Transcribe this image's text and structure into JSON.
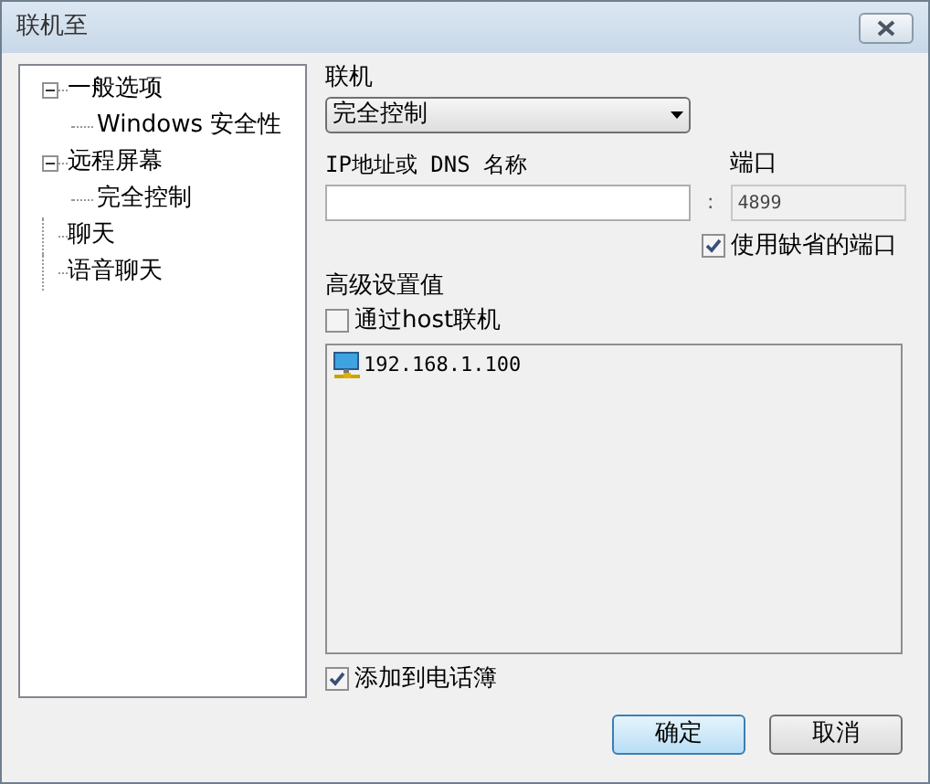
{
  "window": {
    "title": "联机至"
  },
  "tree": [
    {
      "label": "一般选项",
      "expanded": true,
      "children": [
        {
          "label": "Windows 安全性"
        }
      ]
    },
    {
      "label": "远程屏幕",
      "expanded": true,
      "children": [
        {
          "label": "完全控制"
        }
      ]
    },
    {
      "label": "聊天"
    },
    {
      "label": "语音聊天"
    }
  ],
  "connection": {
    "label": "联机",
    "value": "完全控制"
  },
  "address": {
    "label": "IP地址或 DNS 名称",
    "separator": ":"
  },
  "port": {
    "label": "端口",
    "value": "4899",
    "disabled": true
  },
  "default_port": {
    "label": "使用缺省的端口",
    "checked": true
  },
  "advanced": {
    "label": "高级设置值"
  },
  "via_host": {
    "label": "通过host联机",
    "checked": false
  },
  "hosts": [
    {
      "label": "192.168.1.100"
    }
  ],
  "add_to_phonebook": {
    "label": "添加到电话簿",
    "checked": true
  },
  "buttons": [
    {
      "label": "确定",
      "kind": "default"
    },
    {
      "label": "取消",
      "kind": "normal"
    }
  ]
}
